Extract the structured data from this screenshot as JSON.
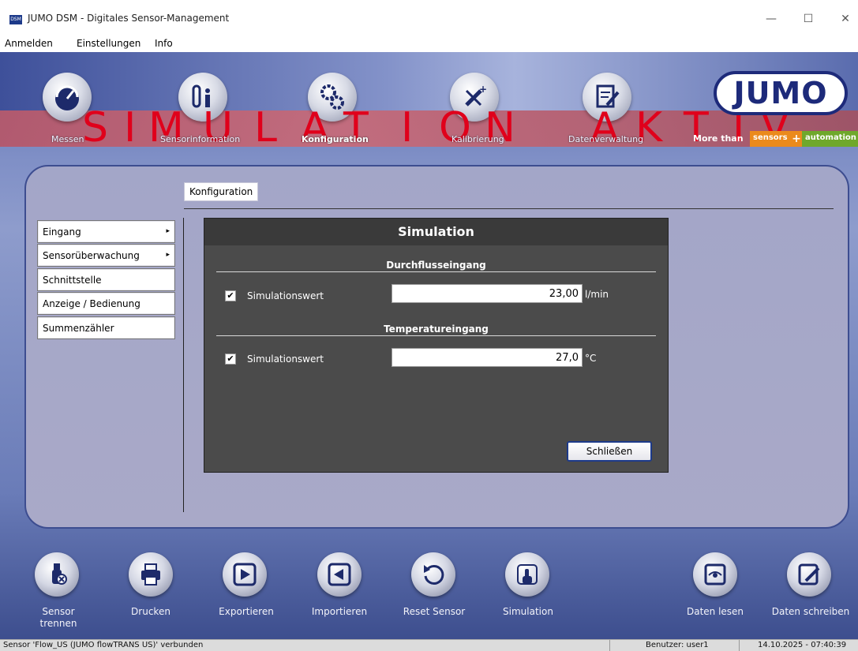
{
  "window": {
    "app_icon_text": "DSM",
    "title": "JUMO DSM - Digitales Sensor-Management",
    "minimize_glyph": "—",
    "maximize_glyph": "☐",
    "close_glyph": "✕"
  },
  "menu": {
    "items": [
      "Anmelden",
      "Einstellungen",
      "Info"
    ]
  },
  "banner": {
    "letters": [
      "S",
      "I",
      "M",
      "U",
      "L",
      "A",
      "T",
      "I",
      "O",
      "N",
      "A",
      "K",
      "T",
      "I",
      "V"
    ],
    "more_than": "More than",
    "sensors": "sensors",
    "plus": "+",
    "automation": "automation",
    "logo_text": "JUMO"
  },
  "nav": {
    "items": [
      {
        "label": "Messen",
        "icon": "gauge-icon"
      },
      {
        "label": "Sensorinformation",
        "icon": "sensor-info-icon"
      },
      {
        "label": "Konfiguration",
        "icon": "gears-icon",
        "active": true
      },
      {
        "label": "Kalibrierung",
        "icon": "tools-icon"
      },
      {
        "label": "Datenverwaltung",
        "icon": "document-edit-icon"
      }
    ]
  },
  "breadcrumb": "Konfiguration",
  "sidebar": {
    "items": [
      {
        "label": "Eingang",
        "submenu": "▸"
      },
      {
        "label": "Sensorüberwachung",
        "submenu": "▸"
      },
      {
        "label": "Schnittstelle"
      },
      {
        "label": "Anzeige / Bedienung"
      },
      {
        "label": "Summenzähler"
      }
    ]
  },
  "dialog": {
    "title": "Simulation",
    "sections": [
      {
        "title": "Durchflusseingang",
        "label": "Simulationswert",
        "checked": "✔",
        "value": "23,00",
        "unit": "l/min"
      },
      {
        "title": "Temperatureingang",
        "label": "Simulationswert",
        "checked": "✔",
        "value": "27,0",
        "unit": "°C"
      }
    ],
    "close_label": "Schließen"
  },
  "toolbar": {
    "items": [
      {
        "label": "Sensor\ntrennen",
        "icon": "usb-disconnect-icon"
      },
      {
        "label": "Drucken",
        "icon": "printer-icon"
      },
      {
        "label": "Exportieren",
        "icon": "export-icon"
      },
      {
        "label": "Importieren",
        "icon": "import-icon"
      },
      {
        "label": "Reset Sensor",
        "icon": "reset-icon"
      },
      {
        "label": "Simulation",
        "icon": "simulation-icon"
      },
      {
        "label": "Daten lesen",
        "icon": "eye-icon"
      },
      {
        "label": "Daten schreiben",
        "icon": "write-icon"
      }
    ]
  },
  "status": {
    "message": "Sensor 'Flow_US (JUMO flowTRANS US)' verbunden",
    "user": "Benutzer: user1",
    "datetime": "14.10.2025 - 07:40:39"
  }
}
